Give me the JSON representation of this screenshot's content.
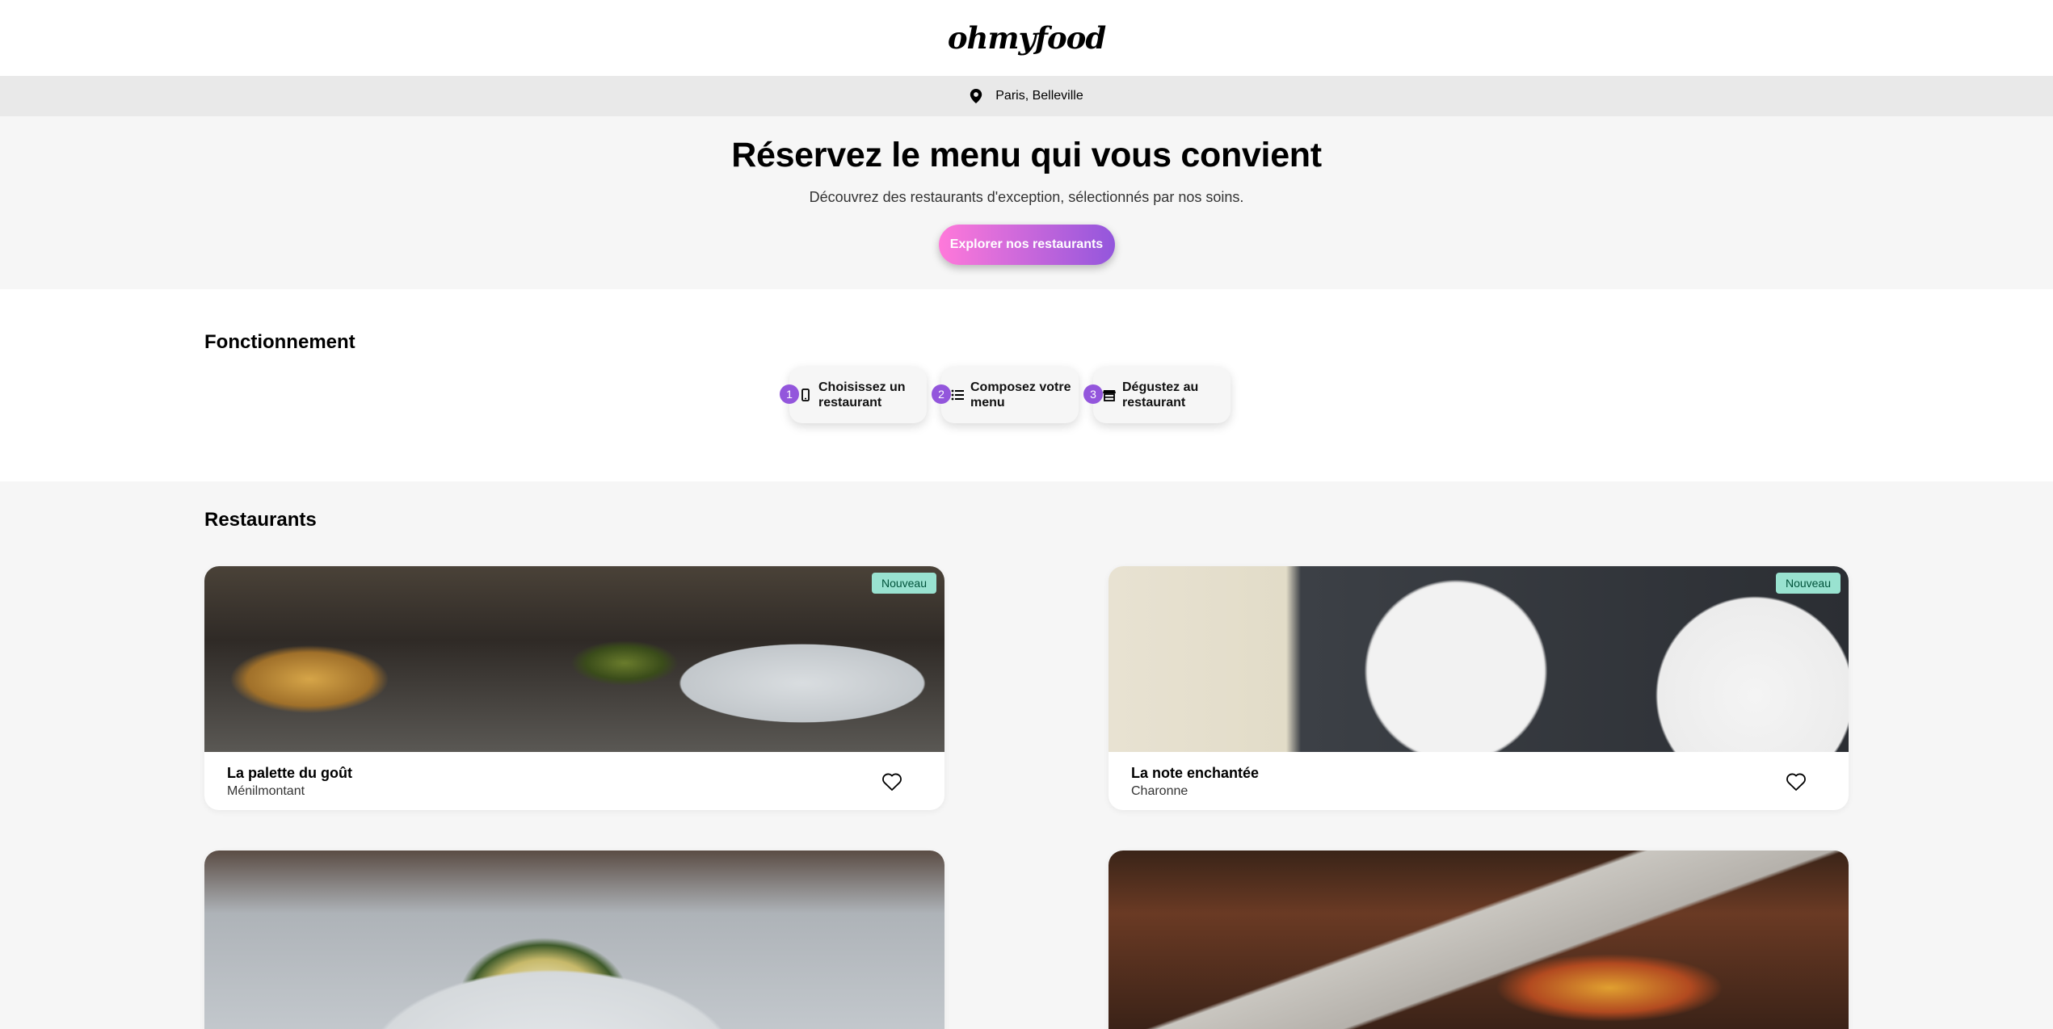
{
  "header": {
    "logo": "ohmyfood"
  },
  "location": {
    "icon": "map-pin-icon",
    "text": "Paris, Belleville"
  },
  "hero": {
    "title": "Réservez le menu qui vous convient",
    "subtitle": "Découvrez des restaurants d'exception, sélectionnés par nos soins.",
    "cta_label": "Explorer nos restaurants"
  },
  "how": {
    "title": "Fonctionnement",
    "steps": [
      {
        "number": "1",
        "icon": "mobile-phone-icon",
        "line1": "Choisissez un",
        "line2": "restaurant"
      },
      {
        "number": "2",
        "icon": "list-icon",
        "line1": "Composez votre",
        "line2": "menu"
      },
      {
        "number": "3",
        "icon": "store-icon",
        "line1": "Dégustez au",
        "line2": "restaurant"
      }
    ]
  },
  "restaurants": {
    "title": "Restaurants",
    "items": [
      {
        "name": "La palette du goût",
        "area": "Ménilmontant",
        "badge": "Nouveau"
      },
      {
        "name": "La note enchantée",
        "area": "Charonne",
        "badge": "Nouveau"
      }
    ]
  },
  "colors": {
    "accent_purple": "#9356dc",
    "accent_pink": "#ff79da",
    "badge_green": "#99e2d0"
  }
}
